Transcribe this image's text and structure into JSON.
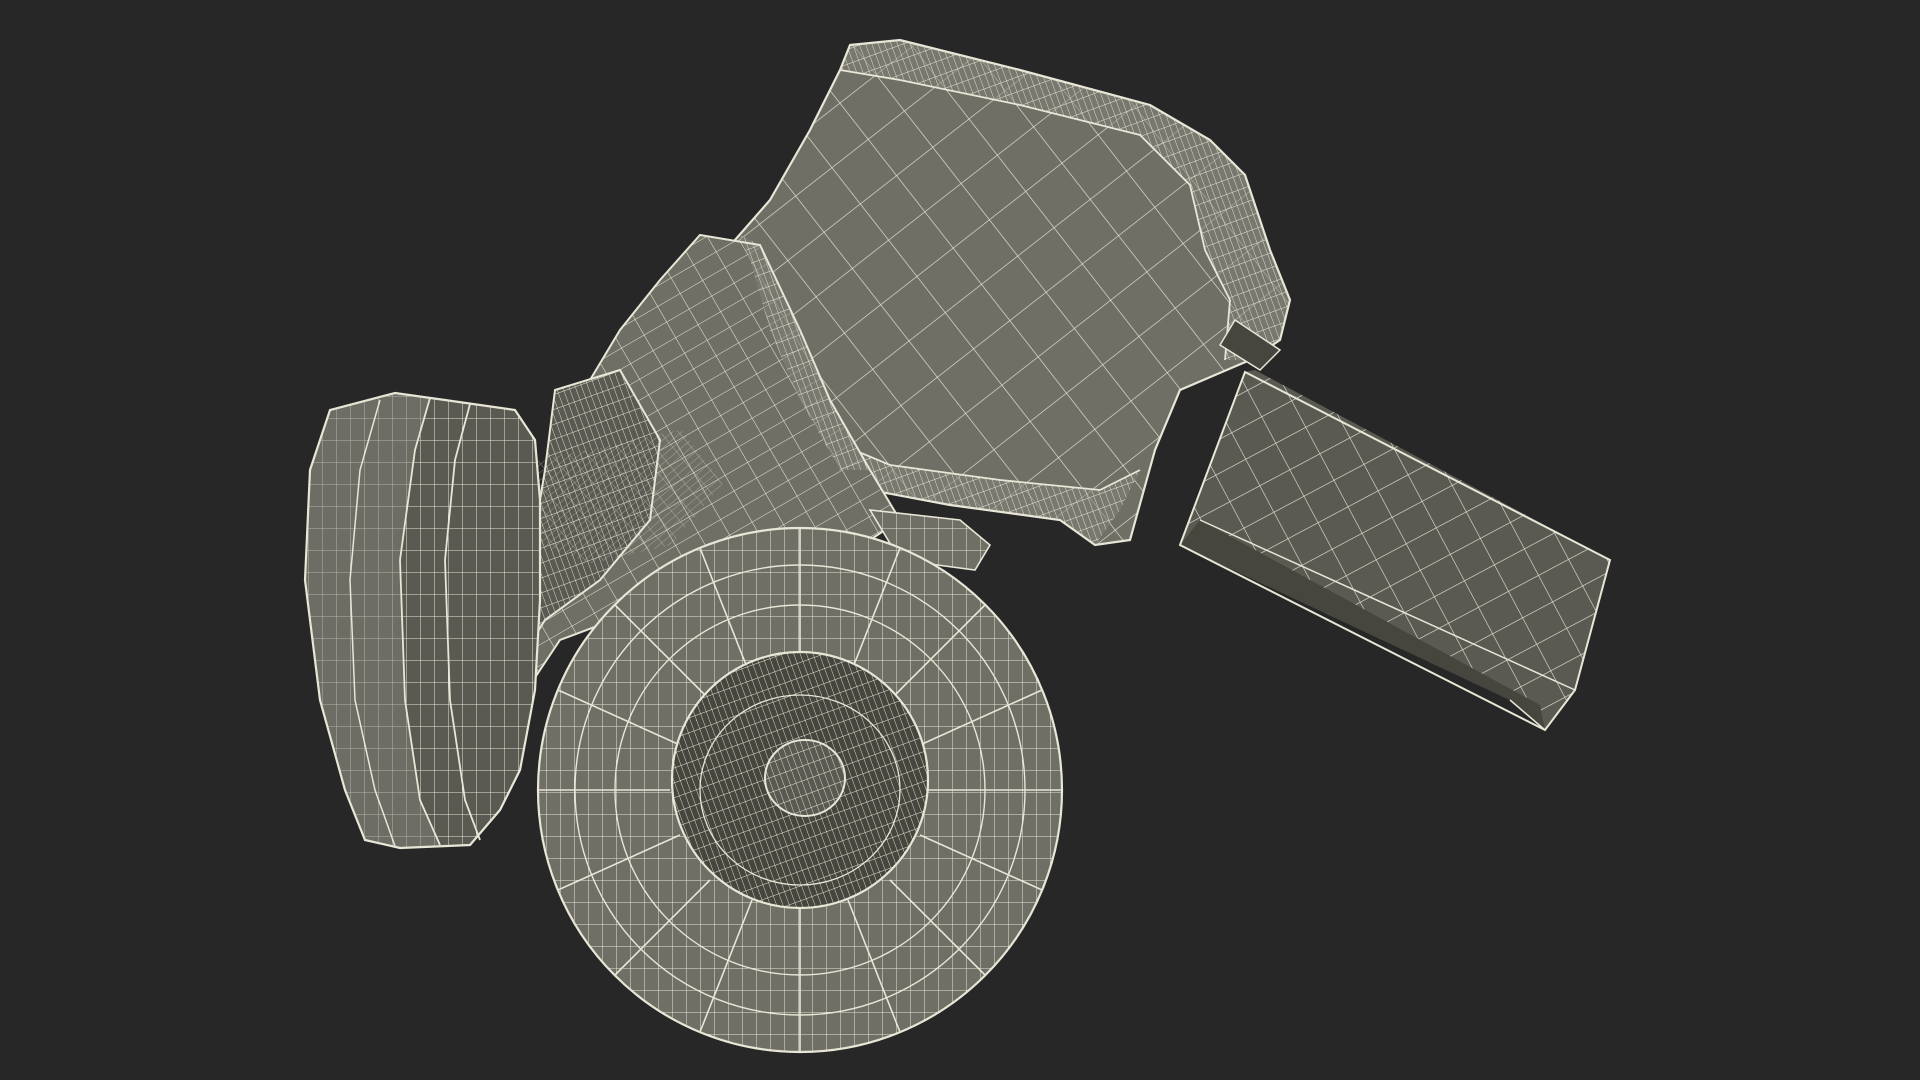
{
  "scene": {
    "background_color": "#272727",
    "model_base_color": "#6f6f66",
    "wire_color": "#e8e6d6",
    "subject_icon": "respirator-mask-icon",
    "view_mode": "wireframe-on-shaded"
  }
}
